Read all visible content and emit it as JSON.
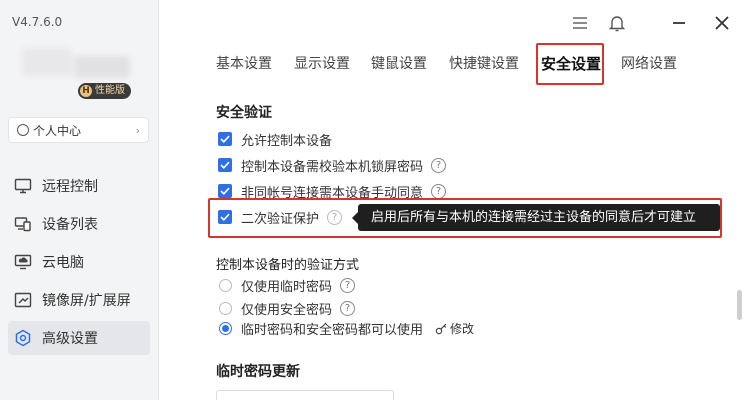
{
  "app": {
    "version": "V4.7.6.0"
  },
  "user": {
    "badge_letter": "H",
    "badge_text": "性能版"
  },
  "sidebar": {
    "personal_center": "个人中心",
    "items": [
      {
        "label": "远程控制",
        "icon": "monitor-icon"
      },
      {
        "label": "设备列表",
        "icon": "devices-icon"
      },
      {
        "label": "云电脑",
        "icon": "cloud-pc-icon"
      },
      {
        "label": "镜像屏/扩展屏",
        "icon": "mirror-screen-icon"
      },
      {
        "label": "高级设置",
        "icon": "settings-icon",
        "active": true
      }
    ]
  },
  "tabs": [
    "基本设置",
    "显示设置",
    "键鼠设置",
    "快捷键设置",
    "安全设置",
    "网络设置"
  ],
  "active_tab": "安全设置",
  "security": {
    "title": "安全验证",
    "options": [
      {
        "label": "允许控制本设备",
        "checked": true
      },
      {
        "label": "控制本设备需校验本机锁屏密码",
        "checked": true
      },
      {
        "label": "非同帐号连接需本设备手动同意",
        "checked": true
      },
      {
        "label": "二次验证保护",
        "checked": true
      }
    ],
    "tooltip": "启用后所有与本机的连接需经过主设备的同意后才可建立"
  },
  "verify_method": {
    "title": "控制本设备时的验证方式",
    "options": [
      {
        "label": "仅使用临时密码",
        "selected": false
      },
      {
        "label": "仅使用安全密码",
        "selected": false
      },
      {
        "label": "临时密码和安全密码都可以使用",
        "selected": true
      }
    ],
    "modify_label": "修改"
  },
  "temp_password": {
    "title": "临时密码更新"
  },
  "colors": {
    "accent": "#2f6fe6",
    "highlight": "#d9342b"
  }
}
